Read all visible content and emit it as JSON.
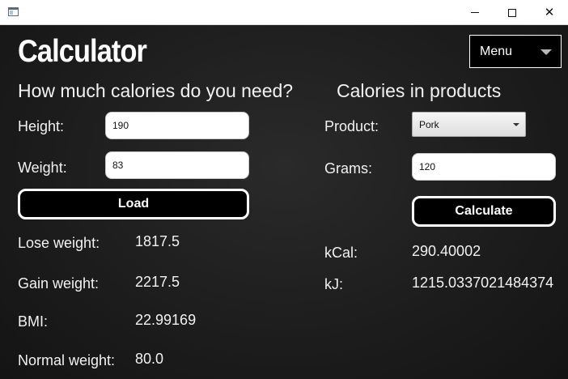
{
  "app": {
    "title": "Calculator",
    "menu_label": "Menu"
  },
  "left": {
    "heading": "How much calories do you need?",
    "height_label": "Height:",
    "height_value": "190",
    "weight_label": "Weight:",
    "weight_value": "83",
    "load_label": "Load",
    "results": [
      {
        "label": "Lose weight:",
        "value": "1817.5"
      },
      {
        "label": "Gain weight:",
        "value": "2217.5"
      },
      {
        "label": "BMI:",
        "value": "22.99169"
      },
      {
        "label": "Normal weight:",
        "value": "80.0"
      }
    ]
  },
  "right": {
    "heading": "Calories in products",
    "product_label": "Product:",
    "product_value": "Pork",
    "grams_label": "Grams:",
    "grams_value": "120",
    "calculate_label": "Calculate",
    "results": [
      {
        "label": "kCal:",
        "value": "290.40002"
      },
      {
        "label": "kJ:",
        "value": "1215.0337021484374"
      }
    ]
  },
  "window_controls": {
    "close_glyph": "✕"
  },
  "icons": [
    "app-window-icon",
    "minimize-icon",
    "maximize-icon",
    "close-icon",
    "chevron-down-icon"
  ]
}
